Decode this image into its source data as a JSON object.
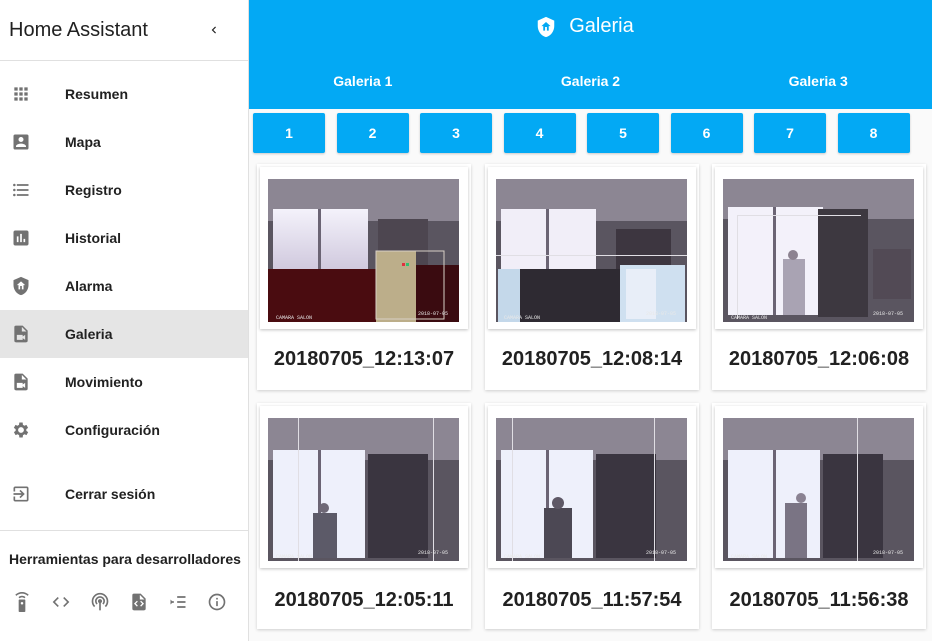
{
  "sidebar": {
    "title": "Home Assistant",
    "items": [
      {
        "label": "Resumen",
        "icon": "apps-grid-icon"
      },
      {
        "label": "Mapa",
        "icon": "account-box-icon"
      },
      {
        "label": "Registro",
        "icon": "format-list-icon"
      },
      {
        "label": "Historial",
        "icon": "chart-bar-icon"
      },
      {
        "label": "Alarma",
        "icon": "shield-home-icon"
      },
      {
        "label": "Galeria",
        "icon": "file-video-icon",
        "active": true
      },
      {
        "label": "Movimiento",
        "icon": "file-video-icon"
      },
      {
        "label": "Configuración",
        "icon": "gear-icon"
      }
    ],
    "logout": "Cerrar sesión",
    "dev_tools_title": "Herramientas para desarrolladores",
    "dev_tools_icons": [
      "remote-icon",
      "code-brackets-icon",
      "access-point-icon",
      "file-code-icon",
      "format-list-icon",
      "info-icon"
    ]
  },
  "header": {
    "title": "Galeria",
    "icon": "shield-home-icon",
    "tabs": [
      "Galeria 1",
      "Galeria 2",
      "Galeria 3"
    ]
  },
  "pager": [
    "1",
    "2",
    "3",
    "4",
    "5",
    "6",
    "7",
    "8"
  ],
  "gallery": [
    "20180705_12:13:07",
    "20180705_12:08:14",
    "20180705_12:06:08",
    "20180705_12:05:11",
    "20180705_11:57:54",
    "20180705_11:56:38"
  ],
  "colors": {
    "primary": "#03a9f4",
    "sidebar_active": "#e5e5e5",
    "icon": "#727272"
  }
}
